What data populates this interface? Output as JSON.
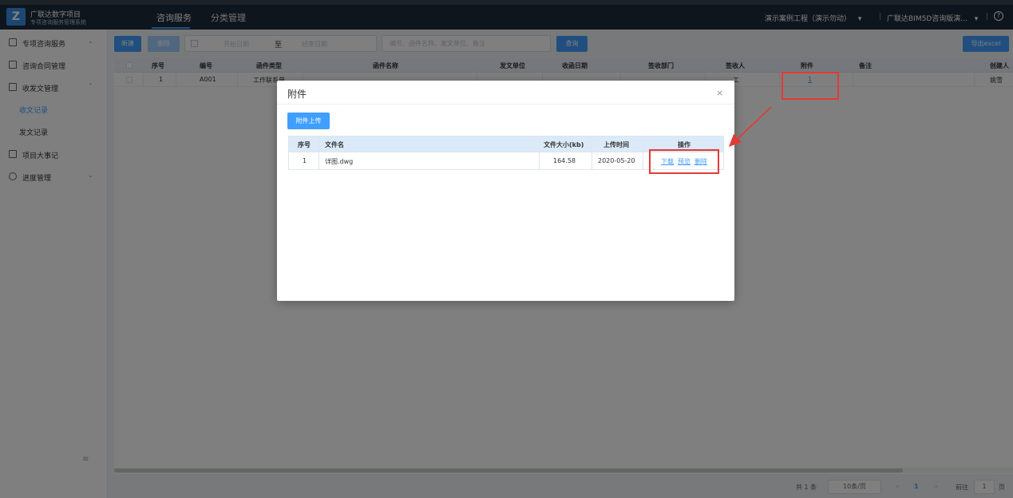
{
  "header": {
    "logo_letter": "Z",
    "brand_line1": "广联达数字项目",
    "brand_line2": "专项咨询服务管理系统",
    "tabs": [
      {
        "label": "咨询服务",
        "active": true
      },
      {
        "label": "分类管理",
        "active": false
      }
    ],
    "project_selector": "演示案例工程（演示勿动）",
    "org_selector": "广联达BIM5D咨询版演...",
    "divider": "|",
    "dropdown_arrow": "▾",
    "help_glyph": "?"
  },
  "sidebar": {
    "items": [
      {
        "label": "专项咨询服务",
        "icon": "document-icon",
        "chevron": "⌄"
      },
      {
        "label": "咨询合同管理",
        "icon": "contract-icon"
      },
      {
        "label": "收发文管理",
        "icon": "folder-icon",
        "chevron": "⌃",
        "expanded": true
      },
      {
        "label": "项目大事记",
        "icon": "record-icon"
      },
      {
        "label": "进度管理",
        "icon": "clock-icon",
        "chevron": "⌄"
      }
    ],
    "sub_items": [
      {
        "label": "收文记录",
        "active": true
      },
      {
        "label": "发文记录",
        "active": false
      }
    ],
    "collapse_glyph": "≡"
  },
  "toolbar": {
    "new_label": "新建",
    "delete_label": "删除",
    "date_start_placeholder": "开始日期",
    "date_separator": "至",
    "date_end_placeholder": "结束日期",
    "search_placeholder": "编号、函件名称、发文单位、备注",
    "query_label": "查询",
    "export_label": "导出excel"
  },
  "table": {
    "columns": [
      "序号",
      "编号",
      "函件类型",
      "函件名称",
      "发文单位",
      "收函日期",
      "签收部门",
      "签收人",
      "附件",
      "备注",
      "创建人"
    ],
    "rows": [
      {
        "seq": "1",
        "code": "A001",
        "type": "工作联系单",
        "name": "",
        "sender": "",
        "date": "",
        "dept": "",
        "signer": "工",
        "attachment": "1",
        "remark": "",
        "creator": "姚雪"
      }
    ]
  },
  "pagination": {
    "total": "共 1 条",
    "page_size": "10条/页",
    "prev": "<",
    "current": "1",
    "next": ">",
    "goto_label": "前往",
    "goto_value": "1",
    "page_suffix": "页"
  },
  "dialog": {
    "title": "附件",
    "close_glyph": "×",
    "upload_label": "附件上传",
    "columns": [
      "序号",
      "文件名",
      "文件大小(kb)",
      "上传时间",
      "操作"
    ],
    "files": [
      {
        "seq": "1",
        "name": "详图.dwg",
        "size": "164.58",
        "time": "2020-05-20",
        "actions": [
          "下载",
          "预览",
          "删除"
        ]
      }
    ]
  },
  "colors": {
    "accent": "#409eff",
    "topbar": "#1d2b3a",
    "annotation": "#e53935"
  }
}
